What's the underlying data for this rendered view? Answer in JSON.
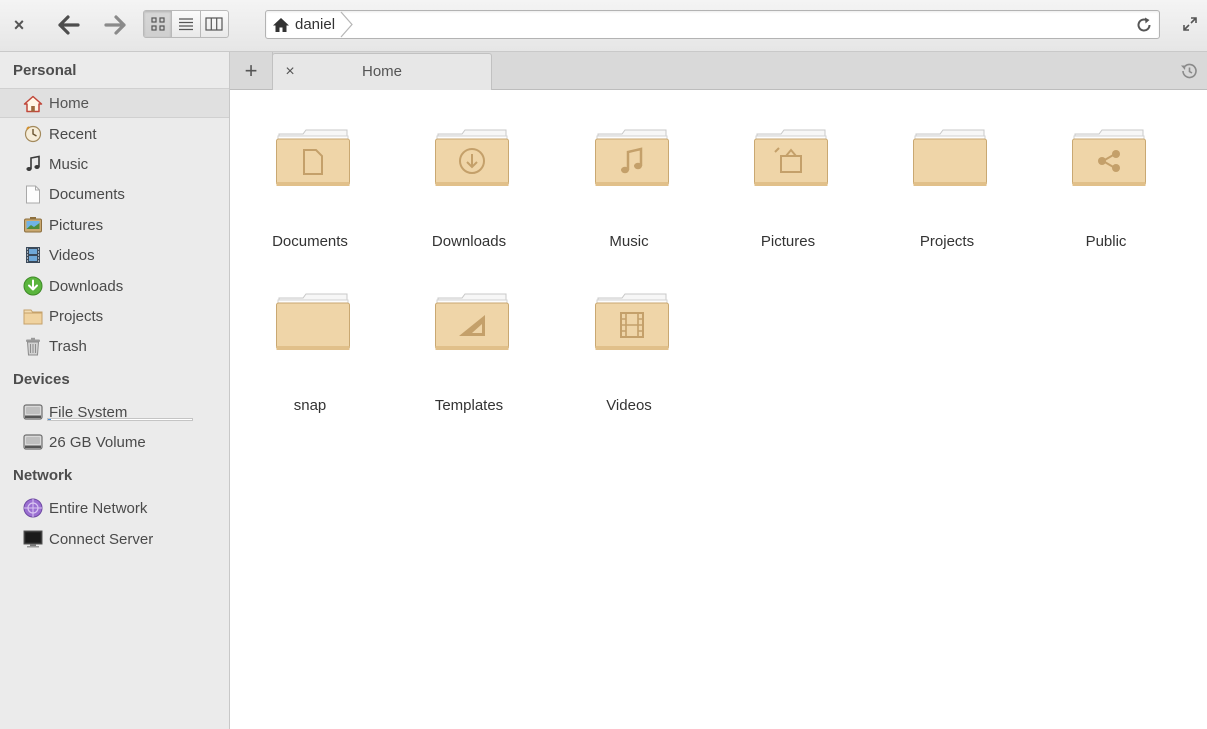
{
  "toolbar": {
    "close_icon": "close-icon",
    "back_icon": "arrow-left-icon",
    "forward_icon": "arrow-right-icon",
    "views": [
      "icon-view",
      "list-view",
      "column-view"
    ],
    "active_view": "icon-view",
    "breadcrumb": "daniel",
    "reload_icon": "reload-icon",
    "maximize_icon": "maximize-icon"
  },
  "sidebar": {
    "personal_heading": "Personal",
    "personal": [
      {
        "label": "Home",
        "icon": "home-icon"
      },
      {
        "label": "Recent",
        "icon": "recent-icon"
      },
      {
        "label": "Music",
        "icon": "music-icon"
      },
      {
        "label": "Documents",
        "icon": "document-icon"
      },
      {
        "label": "Pictures",
        "icon": "pictures-icon"
      },
      {
        "label": "Videos",
        "icon": "video-icon"
      },
      {
        "label": "Downloads",
        "icon": "download-icon"
      },
      {
        "label": "Projects",
        "icon": "folder-icon"
      },
      {
        "label": "Trash",
        "icon": "trash-icon"
      }
    ],
    "selected": "Home",
    "devices_heading": "Devices",
    "devices": [
      {
        "label": "File System",
        "icon": "drive-icon",
        "usage_fraction": 0.02
      },
      {
        "label": "26 GB Volume",
        "icon": "drive-icon"
      }
    ],
    "network_heading": "Network",
    "network": [
      {
        "label": "Entire Network",
        "icon": "network-icon"
      },
      {
        "label": "Connect Server",
        "icon": "server-icon"
      }
    ]
  },
  "tabs": {
    "add_label": "+",
    "items": [
      {
        "label": "Home",
        "close": "×"
      }
    ],
    "history_icon": "history-icon"
  },
  "folders": [
    {
      "name": "Documents",
      "emblem": "document"
    },
    {
      "name": "Downloads",
      "emblem": "download"
    },
    {
      "name": "Music",
      "emblem": "music"
    },
    {
      "name": "Pictures",
      "emblem": "pictures"
    },
    {
      "name": "Projects",
      "emblem": "none"
    },
    {
      "name": "Public",
      "emblem": "share"
    },
    {
      "name": "snap",
      "emblem": "none"
    },
    {
      "name": "Templates",
      "emblem": "template"
    },
    {
      "name": "Videos",
      "emblem": "video"
    }
  ],
  "colors": {
    "folder_body": "#efd5a8",
    "folder_emblem": "#c7a36b",
    "sidebar_bg": "#ebebeb",
    "selection_accent": "#4a90d9"
  }
}
